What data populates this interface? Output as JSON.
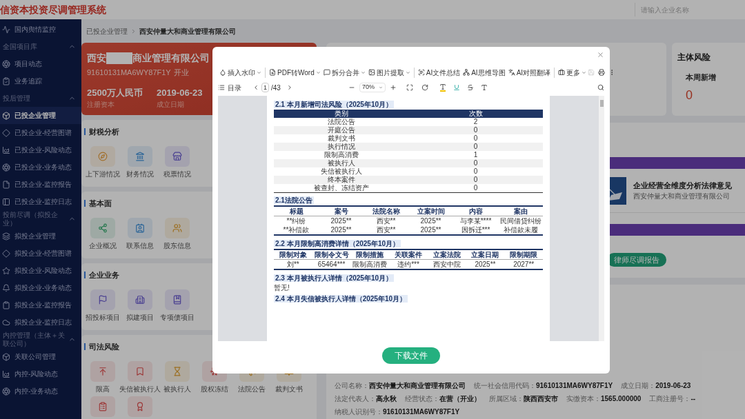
{
  "header": {
    "title": "信资本投资尽调管理系统",
    "search": {
      "placeholder": "请输入企业名称"
    }
  },
  "sidebar": {
    "groups": [
      {
        "items": [
          {
            "label": "国内舆情监控",
            "selected": false
          }
        ]
      },
      {
        "title": "全国项目库",
        "expanded": true,
        "items": [
          {
            "label": "项目动态",
            "selected": false
          },
          {
            "label": "业务追踪",
            "selected": false
          }
        ]
      },
      {
        "title": "投后管理",
        "expanded": true,
        "items": [
          {
            "label": "已投企业管理",
            "selected": true
          },
          {
            "label": "已投企业-经营图谱",
            "selected": false
          },
          {
            "label": "已投企业-风险动态",
            "selected": false
          },
          {
            "label": "已投企业-业务动态",
            "selected": false
          },
          {
            "label": "已投企业-监控报告",
            "selected": false
          },
          {
            "label": "已投企业-监控日志",
            "selected": false
          }
        ]
      },
      {
        "title": "投前尽调（拟投企业）",
        "expanded": true,
        "items": [
          {
            "label": "拟投企业管理",
            "selected": false
          },
          {
            "label": "拟投企业-经营图谱",
            "selected": false
          },
          {
            "label": "拟投企业-风险动态",
            "selected": false
          },
          {
            "label": "拟投企业-业务动态",
            "selected": false
          },
          {
            "label": "拟投企业-监控报告",
            "selected": false
          },
          {
            "label": "拟投企业-监控日志",
            "selected": false
          }
        ]
      },
      {
        "title": "内控管理（主体＋关联公司）",
        "expanded": true,
        "items": [
          {
            "label": "关联公司管理",
            "selected": false
          },
          {
            "label": "内控-风险动态",
            "selected": false
          },
          {
            "label": "内控-业务动态",
            "selected": false
          }
        ]
      }
    ]
  },
  "breadcrumb": [
    "已投企业管理",
    "西安仲量大和商业管理有限公司"
  ],
  "company_card": {
    "name_start": "西安",
    "name_end": "商业管理有限公司",
    "credit_code": "91610131MA6WY87F1Y",
    "status": "开业",
    "stats": [
      {
        "value": "2500万人民币",
        "label": "注册资本"
      },
      {
        "value": "2019-06-23",
        "label": "成立日期"
      }
    ]
  },
  "sections": [
    {
      "title": "财税分析",
      "tiles": [
        {
          "kind": "labeled",
          "label": "上下游情况"
        },
        {
          "kind": "labeled",
          "label": "财务情况"
        },
        {
          "kind": "labeled",
          "label": "税票情况"
        }
      ]
    },
    {
      "title": "基本面",
      "tiles": [
        {
          "kind": "labeled",
          "label": "企业概况"
        },
        {
          "kind": "labeled",
          "label": "联系信息"
        },
        {
          "kind": "labeled",
          "label": "股东信息"
        }
      ]
    },
    {
      "title": "企业业务",
      "tiles": [
        {
          "kind": "labeled",
          "label": "招投标项目"
        },
        {
          "kind": "labeled",
          "label": "拟建项目"
        },
        {
          "kind": "labeled",
          "label": "专项债项目"
        }
      ]
    },
    {
      "title": "司法风险",
      "tiles": [
        {
          "kind": "labeled",
          "label": "限高"
        },
        {
          "kind": "labeled",
          "label": "失信被执行人"
        },
        {
          "kind": "labeled",
          "label": "被执行人"
        },
        {
          "kind": "labeled",
          "label": "股权冻结"
        },
        {
          "kind": "labeled",
          "label": "法院公告"
        },
        {
          "kind": "labeled",
          "label": "裁判文书"
        },
        {
          "kind": "icon_only"
        },
        {
          "kind": "icon_only"
        }
      ]
    }
  ],
  "risk_card": {
    "title": "主体风险",
    "label": "本周新增",
    "value": "0"
  },
  "report": {
    "title": "企业经营全维度分析法律意见",
    "subtitle": "西安仲量大和商业管理有限公司",
    "button": "律师尽调报告"
  },
  "company_info": [
    {
      "label": "公司名称：",
      "value": "西安仲量大和商业管理有限公司"
    },
    {
      "label": "统一社会信用代码：",
      "value": "91610131MA6WY87F1Y"
    },
    {
      "label": "成立日期：",
      "value": "2019-06-23"
    },
    {
      "label": "法定代表人：",
      "value": "高永秋"
    },
    {
      "label": "经营状态：",
      "value": "在营（开业）"
    },
    {
      "label": "所属区域：",
      "value": "陕西西安市"
    },
    {
      "label": "实缴资本：",
      "value": "1565.000000"
    },
    {
      "label": "工商注册号：",
      "value": "--"
    },
    {
      "label": "纳税人识别号：",
      "value": "91610131MA6WY87F1Y"
    }
  ],
  "viewer": {
    "tools": [
      {
        "label": "插入水印",
        "dropdown": true,
        "separator_before": false
      },
      {
        "label": "PDF转Word",
        "dropdown": true,
        "separator_before": true
      },
      {
        "label": "拆分合并",
        "dropdown": true,
        "separator_before": false
      },
      {
        "label": "图片提取",
        "dropdown": true,
        "separator_before": false
      },
      {
        "label": "AI文件总结",
        "dropdown": false,
        "separator_before": true
      },
      {
        "label": "AI思维导图",
        "dropdown": false,
        "separator_before": false
      },
      {
        "label": "AI对照翻译",
        "dropdown": false,
        "separator_before": false
      },
      {
        "label": "更多",
        "dropdown": true,
        "separator_before": true
      }
    ],
    "actions": [
      {
        "disabled": true
      },
      {
        "disabled": false
      },
      {
        "disabled": false
      }
    ],
    "toc_label": "目录",
    "page": "1",
    "page_total": "/43",
    "zoom": "70%",
    "document": [
      {
        "kind": "heading",
        "text": "2.1 本月新增司法风险（2025年10月）"
      },
      {
        "kind": "summary_table",
        "columns": [
          "类别",
          "次数"
        ],
        "rows": [
          [
            "法院公告",
            "2"
          ],
          [
            "开庭公告",
            "0"
          ],
          [
            "裁判文书",
            "0"
          ],
          [
            "执行情况",
            "0"
          ],
          [
            "限制高消费",
            "1"
          ],
          [
            "被执行人",
            "0"
          ],
          [
            "失信被执行人",
            "0"
          ],
          [
            "终本案件",
            "0"
          ],
          [
            "被查封、冻结资产",
            "0"
          ]
        ]
      },
      {
        "kind": "heading",
        "text": "2.1法院公告"
      },
      {
        "kind": "detail_table",
        "columns": [
          "标题",
          "案号",
          "法院名称",
          "立案时间",
          "内容",
          "案由"
        ],
        "rows": [
          [
            "**纠纷",
            "2025**",
            "西安**",
            "2025**",
            "与李某****",
            "民间借贷纠纷"
          ],
          [
            "**补偿款",
            "2025**",
            "西安**",
            "2025**",
            "因拆迁***",
            "补偿款未履"
          ]
        ]
      },
      {
        "kind": "heading",
        "text": "2.2 本月限制高消费详情（2025年10月）"
      },
      {
        "kind": "detail_table",
        "columns": [
          "限制对象",
          "限制令文号",
          "限制措施",
          "关联案件",
          "立案法院",
          "立案日期",
          "限制期限"
        ],
        "rows": [
          [
            "刘**",
            "65464***",
            "限制高消费",
            "违约***",
            "西安中院",
            "2025**",
            "2027**"
          ]
        ]
      },
      {
        "kind": "heading",
        "text": "2.3 本月被执行人详情（2025年10月）"
      },
      {
        "kind": "paragraph",
        "text": "暂无!"
      },
      {
        "kind": "heading",
        "text": "2.4 本月失信被执行人详情（2025年10月）"
      }
    ],
    "download": "下载文件"
  }
}
